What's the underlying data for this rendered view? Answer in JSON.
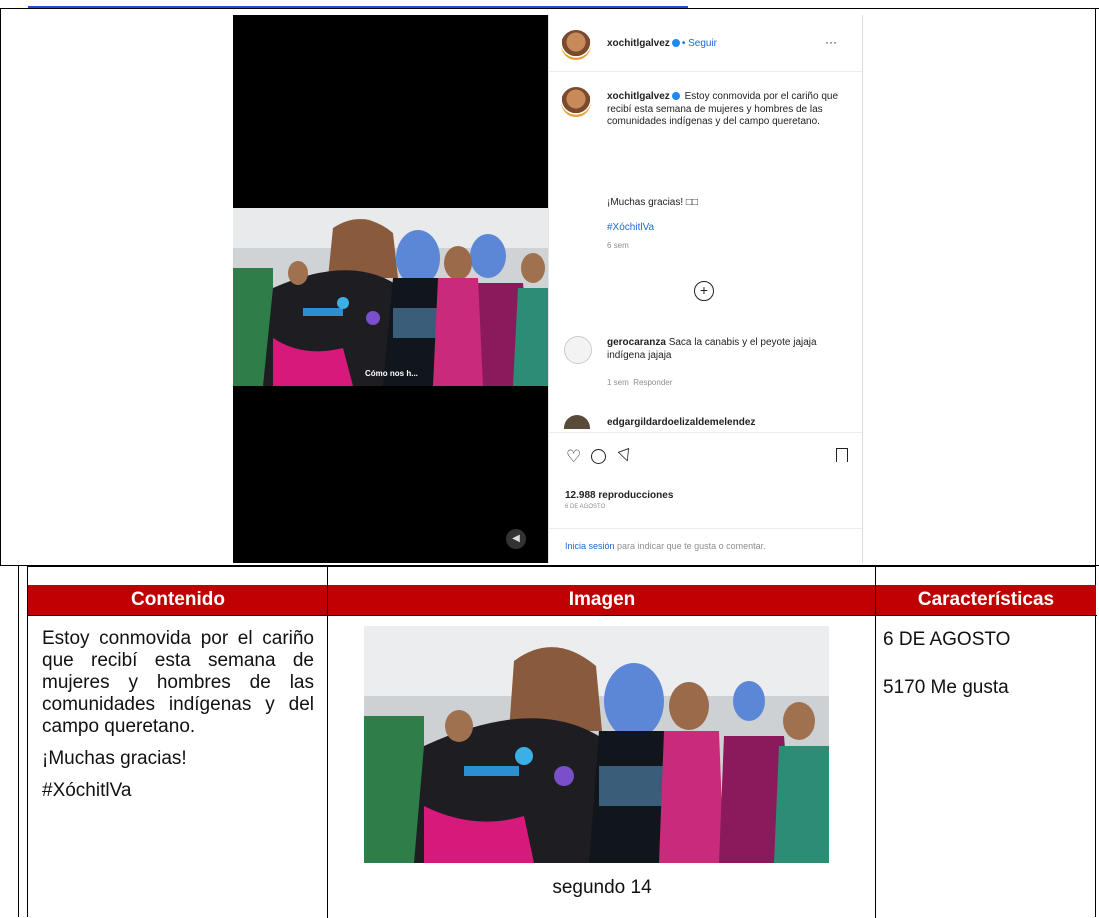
{
  "instagram": {
    "username": "xochitlgalvez",
    "follow_label": "• Seguir",
    "more_label": "···",
    "caption": "Estoy conmovida por el cariño que recibí esta semana de mujeres y hombres de las comunidades indígenas y del campo queretano.",
    "thanks": "¡Muchas gracias! □□",
    "hashtag": "#XóchitlVa",
    "post_age": "6 sem",
    "video_caption": "Cómo nos h...",
    "comments": [
      {
        "user": "gerocaranza",
        "text": "Saca la canabis y el peyote jajaja indígena jajaja",
        "age": "1 sem",
        "reply_label": "Responder"
      },
      {
        "user": "edgargildardoelizaldemelendez",
        "text": "",
        "age": "",
        "reply_label": ""
      }
    ],
    "views": "12.988 reproducciones",
    "date": "6 DE AGOSTO",
    "login_link": "Inicia sesión",
    "login_text": "para indicar que te gusta o comentar."
  },
  "table": {
    "headers": [
      "Contenido",
      "Imagen",
      "Características"
    ],
    "content_paragraphs": [
      "Estoy conmovida por el cariño que recibí esta semana de mujeres y hombres de las comunidades indígenas y del campo queretano.",
      "¡Muchas gracias!",
      "#XóchitlVa"
    ],
    "image_caption": "segundo 14",
    "characteristics": [
      "6 DE AGOSTO",
      "5170 Me gusta"
    ],
    "header_color": "#c00000"
  }
}
